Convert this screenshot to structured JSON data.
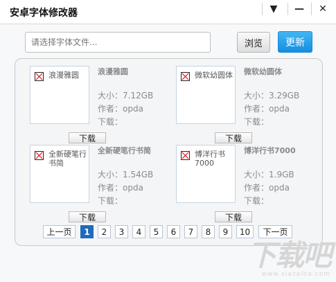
{
  "window": {
    "title": "安卓字体修改器",
    "controls": {
      "menu": "▼",
      "minimize": "—",
      "close": "✕"
    }
  },
  "toolbar": {
    "file_placeholder": "请选择字体文件...",
    "browse_label": "浏览",
    "update_label": "更新"
  },
  "fonts": [
    {
      "preview": "浪漫雅圆",
      "name": "浪漫雅圆",
      "size": "大小：7.12GB",
      "author": "作者：opda",
      "download": "下载：",
      "button": "下载"
    },
    {
      "preview": "微软幼圆体",
      "name": "微软幼圆体",
      "size": "大小：3.29GB",
      "author": "作者：opda",
      "download": "下载：",
      "button": "下载"
    },
    {
      "preview": "全新硬笔行书简",
      "name": "全新硬笔行书简",
      "size": "大小：1.54GB",
      "author": "作者：opda",
      "download": "下载：",
      "button": "下载"
    },
    {
      "preview": "博洋行书7000",
      "name": "博洋行书7000",
      "size": "大小：1.9GB",
      "author": "作者：opda",
      "download": "下载：",
      "button": "下载"
    }
  ],
  "pagination": {
    "prev": "上一页",
    "pages": [
      "1",
      "2",
      "3",
      "4",
      "5",
      "6",
      "7",
      "8",
      "9",
      "10"
    ],
    "current": "1",
    "next": "下一页"
  },
  "watermark": {
    "text": "下载吧",
    "url": "www.xiazaiba.com"
  },
  "colors": {
    "accent": "#168ee0",
    "active_page": "#1e6bbd"
  }
}
